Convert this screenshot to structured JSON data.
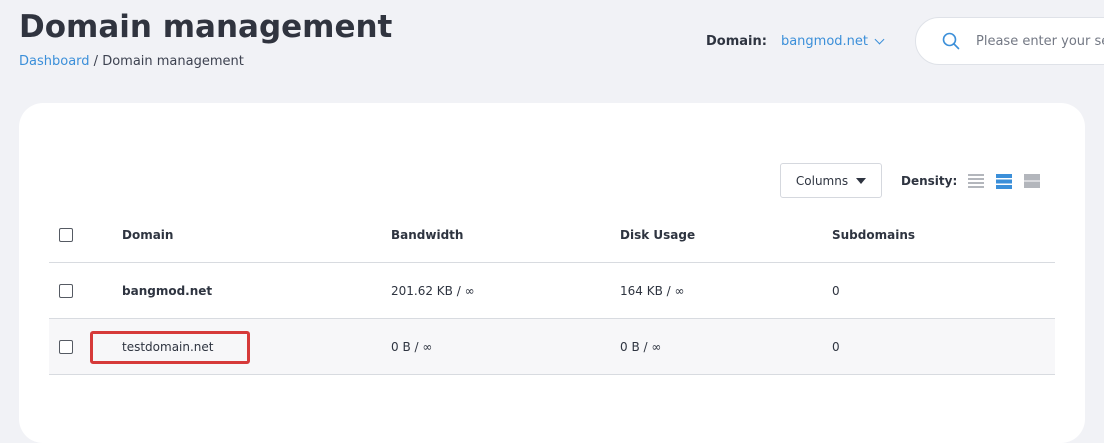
{
  "header": {
    "title": "Domain management",
    "breadcrumb": {
      "home": "Dashboard",
      "separator": " / ",
      "current": "Domain management"
    },
    "domain_selector": {
      "label": "Domain:",
      "value": "bangmod.net",
      "icon": "chevron-down-icon"
    },
    "search": {
      "placeholder": "Please enter your search",
      "icon": "search-icon"
    }
  },
  "toolbar": {
    "columns_label": "Columns",
    "density_label": "Density:",
    "density_options": [
      "compact",
      "normal",
      "comfortable"
    ],
    "density_selected": "normal"
  },
  "table": {
    "columns": [
      "Domain",
      "Bandwidth",
      "Disk Usage",
      "Subdomains"
    ],
    "rows": [
      {
        "domain": "bangmod.net",
        "bandwidth": "201.62 KB / ∞",
        "disk_usage": "164 KB / ∞",
        "subdomains": "0"
      },
      {
        "domain": "testdomain.net",
        "bandwidth": "0 B / ∞",
        "disk_usage": "0 B / ∞",
        "subdomains": "0"
      }
    ]
  },
  "colors": {
    "accent": "#3b8fd9",
    "highlight": "#d63a3a",
    "background": "#f1f2f6"
  }
}
